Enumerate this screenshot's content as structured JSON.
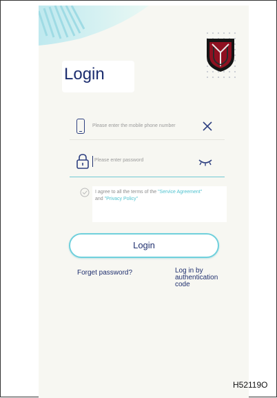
{
  "screen": {
    "title": "Login",
    "phone": {
      "placeholder": "Please enter the mobile phone number"
    },
    "password": {
      "placeholder": "Please enter password"
    },
    "agreement": {
      "prefix": "I agree to all the terms of the ",
      "service_link": "\"Service Agreement\"",
      "and": "and ",
      "privacy_link": "\"Privacy Policy\""
    },
    "login_button": "Login",
    "forget_password": "Forget password?",
    "auth_code_login": "Log in by authentication code"
  },
  "figure_id": "H52119O",
  "icons": [
    "phone-icon",
    "clear-icon",
    "lock-icon",
    "eye-closed-icon",
    "check-circle-icon",
    "brand-logo"
  ],
  "colors": {
    "title": "#1d2e6f",
    "accent": "#4ec2cf",
    "button_border": "#6fd0dc",
    "background": "#f7f7f2"
  }
}
